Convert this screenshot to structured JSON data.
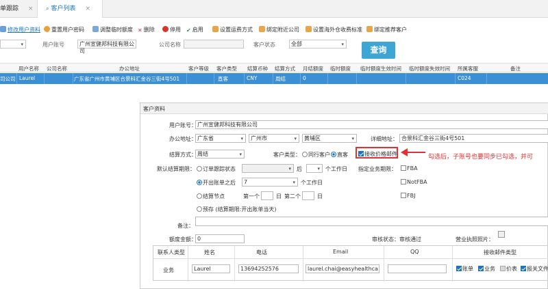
{
  "tabs": [
    {
      "label": "单跟踪",
      "close": "×",
      "active": false
    },
    {
      "label": "客户列表",
      "close": "×",
      "active": true
    }
  ],
  "toolbar": {
    "edit_user": "修改用户资料",
    "reset_pwd": "重置用户密码",
    "adjust_credit": "调整临时额度",
    "delete": "删除",
    "disable": "停用",
    "enable": "启用",
    "set_freight": "设置运费方式",
    "bind_company": "绑定附近公司",
    "set_overseas": "设置海外仓收费标准",
    "bind_referrer": "绑定推荐客户"
  },
  "filter": {
    "user_account_label": "用户账号",
    "user_account_value": "广州宣健邦科技有限公司",
    "company_name_label": "公司名称",
    "company_name_value": "",
    "customer_status_label": "客户状态",
    "customer_status_value": "全部",
    "query_button": "查询"
  },
  "grid": {
    "headers": [
      "用户名称",
      "公司名称",
      "办公地址",
      "客户等级",
      "客户类型",
      "结算币种",
      "结算方式",
      "月结额度",
      "临时额度",
      "临时额度生效时间",
      "临时额度失效时间",
      "所属客服",
      "备注"
    ],
    "row": {
      "company_frag": "司公司",
      "user_name": "Laurel",
      "address": "广东省广州市黄埔区合景科汇金谷三街4号501",
      "customer_type": "直客",
      "currency": "CNY",
      "settle_method": "周结",
      "monthly_limit": "0",
      "service": "C024"
    }
  },
  "dialog": {
    "title": "客户资料",
    "user_account_label": "用户账号：",
    "user_account_value": "广州宣健邦科技有限公司",
    "office_address_label": "办公地址：",
    "province": "广东省",
    "city": "广州市",
    "district": "黄埔区",
    "detail_address_label": "详细地址：",
    "detail_address_value": "合景科汇金谷三街4号501",
    "settle_method_label": "结算方式：",
    "settle_method_value": "周结",
    "customer_type_label": "客户类型：",
    "customer_type_peer": "同行客户",
    "customer_type_direct": "直客",
    "receive_price_mail": "接收价格邮件",
    "default_period_label": "默认结算期限：",
    "opt_order_status": "订单跟踪状态",
    "after_label": "后",
    "workdays_label": "个工作日",
    "opt_after_bill": "开出账单之后",
    "after_bill_days": "7",
    "workdays_label2": "个工作日",
    "opt_settle_node": "结算节点",
    "first_label": "第一个",
    "day_label": "日",
    "second_label": "第二个",
    "day_label2": "日",
    "opt_prepaid": "预存 (结算期限:开出账单当天)",
    "business_period_label": "指定业务期限：",
    "fba": "FBA",
    "notfba": "NotFBA",
    "fbj": "FBJ",
    "remark_label": "备注：",
    "credit_label": "额度金额：",
    "credit_value": "0",
    "audit_status_label": "审核状态：",
    "audit_status_value": "审核通过",
    "license_label": "营业执照照片：",
    "contact_headers": [
      "联系人类型",
      "姓名",
      "电话",
      "Email",
      "QQ",
      "接收邮件类型"
    ],
    "contact_type": "业务",
    "contact_name": "Laurel",
    "contact_phone": "13694252576",
    "contact_email": "laurel.chai@easyhealthca",
    "contact_qq": "",
    "mail_types": [
      "账单",
      "业务",
      "价表",
      "报关文件"
    ]
  },
  "annotation": "勾选后，子账号也要同步已勾选，并可",
  "colors": {
    "accent": "#1a73c9",
    "row_highlight": "#3b8fd4",
    "query_button": "#3ea6d5",
    "annotation_red": "#e03030"
  }
}
